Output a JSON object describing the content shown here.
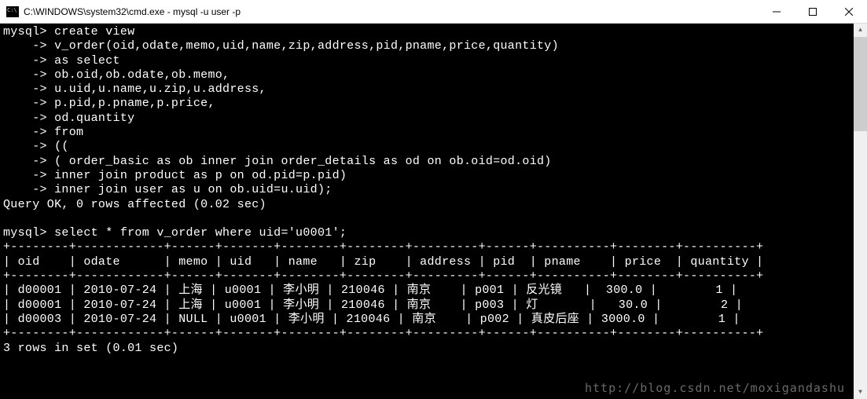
{
  "titlebar": {
    "title": "C:\\WINDOWS\\system32\\cmd.exe - mysql  -u user -p"
  },
  "terminal": {
    "prompt1": "mysql>",
    "cont": "    ->",
    "sql_lines": [
      "mysql> create view",
      "    -> v_order(oid,odate,memo,uid,name,zip,address,pid,pname,price,quantity)",
      "    -> as select",
      "    -> ob.oid,ob.odate,ob.memo,",
      "    -> u.uid,u.name,u.zip,u.address,",
      "    -> p.pid,p.pname,p.price,",
      "    -> od.quantity",
      "    -> from",
      "    -> ((",
      "    -> ( order_basic as ob inner join order_details as od on ob.oid=od.oid)",
      "    -> inner join product as p on od.pid=p.pid)",
      "    -> inner join user as u on ob.uid=u.uid);",
      "Query OK, 0 rows affected (0.02 sec)",
      "",
      "mysql> select * from v_order where uid='u0001';"
    ],
    "table": {
      "border": "+--------+------------+------+-------+--------+--------+---------+------+----------+--------+----------+",
      "header": "| oid    | odate      | memo | uid   | name   | zip    | address | pid  | pname    | price  | quantity |",
      "rows": [
        "| d00001 | 2010-07-24 | 上海 | u0001 | 李小明 | 210046 | 南京    | p001 | 反光镜   |  300.0 |        1 |",
        "| d00001 | 2010-07-24 | 上海 | u0001 | 李小明 | 210046 | 南京    | p003 | 灯       |   30.0 |        2 |",
        "| d00003 | 2010-07-24 | NULL | u0001 | 李小明 | 210046 | 南京    | p002 | 真皮后座 | 3000.0 |        1 |"
      ]
    },
    "footer": "3 rows in set (0.01 sec)"
  },
  "watermark": "http://blog.csdn.net/moxigandashu",
  "chart_data": {
    "type": "table",
    "title": "select * from v_order where uid='u0001'",
    "columns": [
      "oid",
      "odate",
      "memo",
      "uid",
      "name",
      "zip",
      "address",
      "pid",
      "pname",
      "price",
      "quantity"
    ],
    "rows": [
      {
        "oid": "d00001",
        "odate": "2010-07-24",
        "memo": "上海",
        "uid": "u0001",
        "name": "李小明",
        "zip": "210046",
        "address": "南京",
        "pid": "p001",
        "pname": "反光镜",
        "price": 300.0,
        "quantity": 1
      },
      {
        "oid": "d00001",
        "odate": "2010-07-24",
        "memo": "上海",
        "uid": "u0001",
        "name": "李小明",
        "zip": "210046",
        "address": "南京",
        "pid": "p003",
        "pname": "灯",
        "price": 30.0,
        "quantity": 2
      },
      {
        "oid": "d00003",
        "odate": "2010-07-24",
        "memo": null,
        "uid": "u0001",
        "name": "李小明",
        "zip": "210046",
        "address": "南京",
        "pid": "p002",
        "pname": "真皮后座",
        "price": 3000.0,
        "quantity": 1
      }
    ],
    "rows_in_set": 3,
    "elapsed_sec": 0.01
  }
}
